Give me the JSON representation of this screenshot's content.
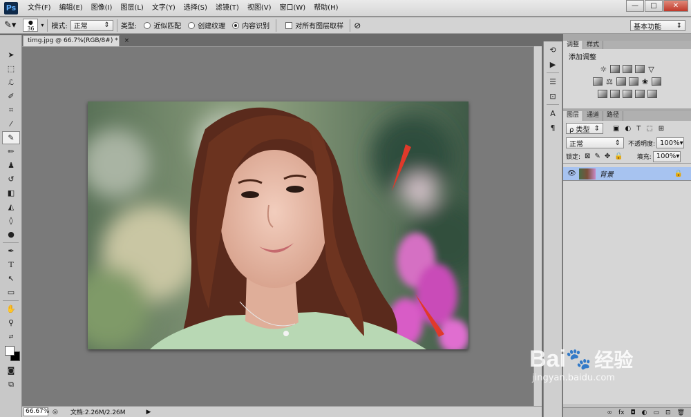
{
  "app": {
    "logo": "Ps"
  },
  "menu": [
    "文件(F)",
    "编辑(E)",
    "图像(I)",
    "图层(L)",
    "文字(Y)",
    "选择(S)",
    "滤镜(T)",
    "视图(V)",
    "窗口(W)",
    "帮助(H)"
  ],
  "window_controls": {
    "minimize": "—",
    "restore": "□",
    "close": "✕"
  },
  "options": {
    "brush_size": "36",
    "mode_label": "模式:",
    "mode_value": "正常",
    "type_label": "类型:",
    "radio_1": "近似匹配",
    "radio_2": "创建纹理",
    "radio_3": "内容识别",
    "sample_all": "对所有图层取样",
    "workspace": "基本功能"
  },
  "document": {
    "tab": "timg.jpg @ 66.7%(RGB/8#) *",
    "tab_close": "×"
  },
  "status": {
    "zoom": "66.67%",
    "doc": "文档:2.26M/2.26M"
  },
  "adjustments": {
    "tabs": [
      "调整",
      "样式"
    ],
    "heading": "添加调整"
  },
  "layers": {
    "tabs": [
      "图层",
      "通道",
      "路径"
    ],
    "filter": "ρ 类型",
    "blend": "正常",
    "opacity_label": "不透明度:",
    "opacity": "100%",
    "lock_label": "锁定:",
    "fill_label": "填充:",
    "fill": "100%",
    "layer_name": "背景",
    "footer": [
      "∞",
      "fx",
      "◘",
      "◐",
      "▭",
      "⊡",
      "🗑"
    ]
  },
  "watermark": {
    "brand": "Bai",
    "brand2": "经验",
    "url": "jingyan.baidu.com"
  },
  "colors": {
    "layer_selected": "#a7c3f0",
    "arrow": "#e0392a"
  }
}
